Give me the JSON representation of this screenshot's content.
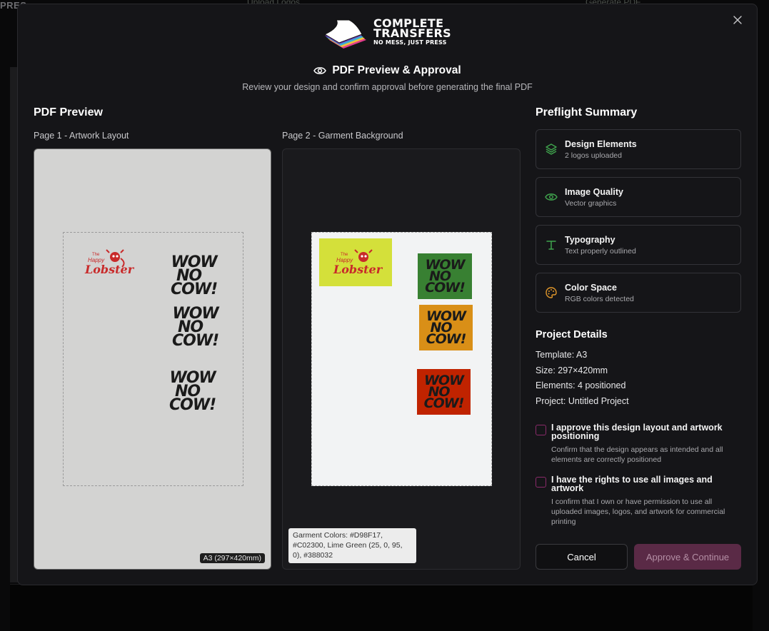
{
  "background": {
    "brand_fragment": "PRES",
    "step_upload": "Upload Logos",
    "step_generate": "Generate PDF"
  },
  "logo": {
    "line1": "COMPLETE",
    "line2": "TRANSFERS",
    "tagline": "NO MESS, JUST PRESS"
  },
  "modal": {
    "title": "PDF Preview & Approval",
    "subtitle": "Review your design and confirm approval before generating the final PDF"
  },
  "preview": {
    "heading": "PDF Preview",
    "page1_label": "Page 1 - Artwork Layout",
    "page2_label": "Page 2 - Garment Background",
    "size_badge": "A3 (297×420mm)",
    "garment_note": "Garment Colors: #D98F17, #C02300, Lime Green (25, 0, 95, 0), #388032",
    "artwork": {
      "logo_small": "The",
      "logo_mid": "Happy",
      "logo_main": "Lobster",
      "wow_line1": "WOW",
      "wow_line2": "NO",
      "wow_line3": "COW!"
    }
  },
  "colors": {
    "lime": "#D4E03A",
    "green": "#388032",
    "orange": "#D98F17",
    "red": "#C02300",
    "accent_checkbox": "#8A2A6A",
    "approve_bg": "#5A2A46"
  },
  "preflight": {
    "heading": "Preflight Summary",
    "items": [
      {
        "title": "Design Elements",
        "sub": "2 logos uploaded",
        "icon": "layers-icon"
      },
      {
        "title": "Image Quality",
        "sub": "Vector graphics",
        "icon": "eye-icon"
      },
      {
        "title": "Typography",
        "sub": "Text properly outlined",
        "icon": "type-icon"
      },
      {
        "title": "Color Space",
        "sub": "RGB colors detected",
        "icon": "palette-icon"
      }
    ]
  },
  "project": {
    "heading": "Project Details",
    "template": "Template: A3",
    "size": "Size: 297×420mm",
    "elements": "Elements: 4 positioned",
    "project": "Project: Untitled Project"
  },
  "approvals": [
    {
      "title": "I approve this design layout and artwork positioning",
      "desc": "Confirm that the design appears as intended and all elements are correctly positioned"
    },
    {
      "title": "I have the rights to use all images and artwork",
      "desc": "I confirm that I own or have permission to use all uploaded images, logos, and artwork for commercial printing"
    }
  ],
  "actions": {
    "cancel": "Cancel",
    "approve": "Approve & Continue"
  }
}
